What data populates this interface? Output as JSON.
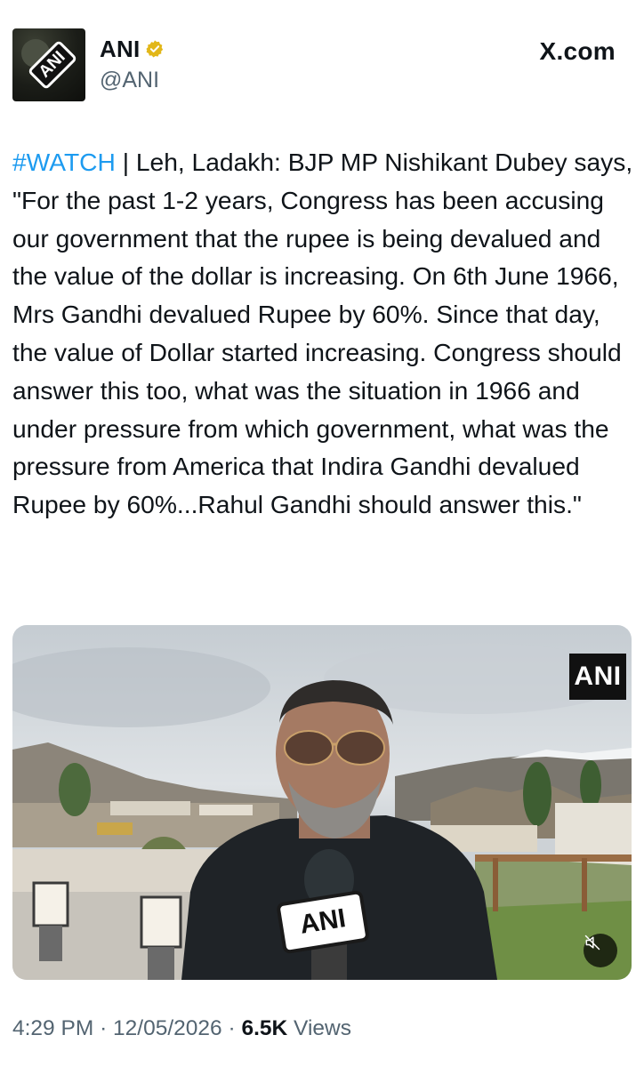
{
  "header": {
    "display_name": "ANI",
    "handle": "@ANI",
    "site_label": "X.com",
    "avatar_text": "ANI"
  },
  "tweet": {
    "hashtag": "#WATCH",
    "body": " | Leh, Ladakh: BJP MP Nishikant Dubey says, \"For the past 1-2 years, Congress has been accusing our government that the rupee is being devalued and the value of the dollar is increasing. On 6th June 1966, Mrs Gandhi devalued Rupee by 60%. Since that day, the value of Dollar started increasing. Congress should answer this too, what was the situation in 1966 and under pressure from which government, what was the pressure from America that Indira Gandhi devalued Rupee by 60%...Rahul Gandhi should answer this.\""
  },
  "media": {
    "watermark": "ANI",
    "mic_label": "ANI"
  },
  "meta": {
    "time": "4:29 PM",
    "date": "12/05/2026",
    "views_count": "6.5K",
    "views_label": "Views",
    "separator": "·"
  },
  "colors": {
    "accent": "#1d9bf0",
    "text": "#0f1419",
    "secondary": "#536471",
    "verified_gold": "#e2b719"
  }
}
